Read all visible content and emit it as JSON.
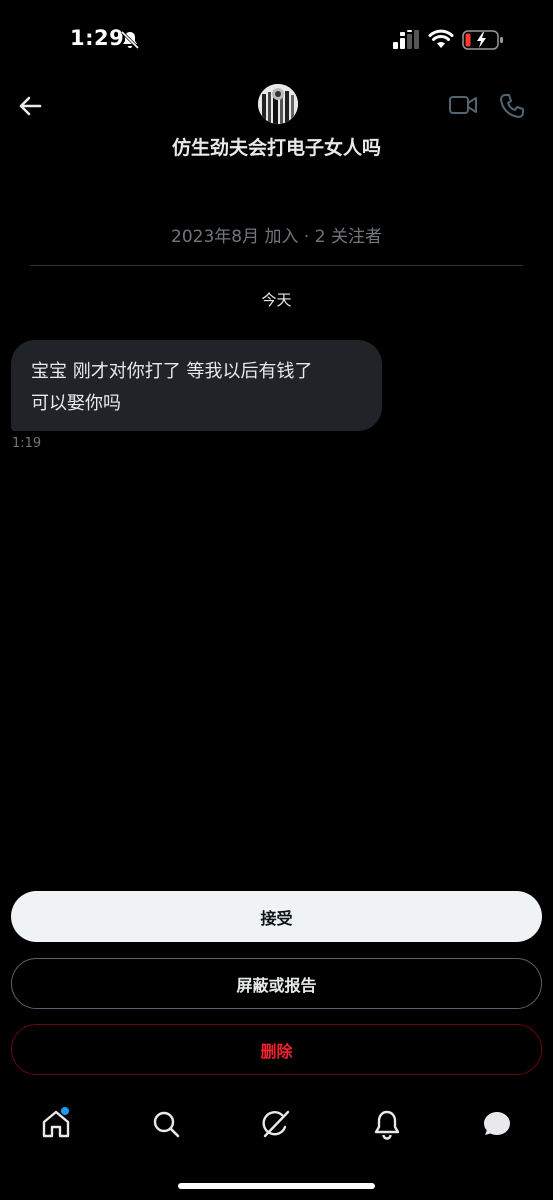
{
  "status_bar": {
    "time": "1:29",
    "icons": [
      "bell-off-icon",
      "cellular-signal-icon",
      "wifi-icon",
      "battery-charging-icon"
    ]
  },
  "header": {
    "contact_name": "仿生劲夫会打电子女人吗",
    "join_info": "2023年8月 加入 · 2 关注者",
    "icons": [
      "back-arrow-icon",
      "video-call-icon",
      "phone-call-icon"
    ]
  },
  "conversation": {
    "date_label": "今天",
    "messages": [
      {
        "line1": "宝宝 刚才对你打了 等我以后有钱了",
        "line2": "可以娶你吗",
        "time": "1:19"
      }
    ]
  },
  "actions": {
    "accept_label": "接受",
    "block_report_label": "屏蔽或报告",
    "delete_label": "删除"
  },
  "bottom_nav": {
    "items": [
      "home-icon",
      "search-icon",
      "grok-icon",
      "notifications-icon",
      "messages-icon"
    ],
    "notification_dot_color": "#1d9bf0"
  },
  "colors": {
    "background": "#000000",
    "bubble": "#202327",
    "muted_text": "#71767b",
    "danger": "#f4212e",
    "accept_bg": "#eff3f4"
  }
}
